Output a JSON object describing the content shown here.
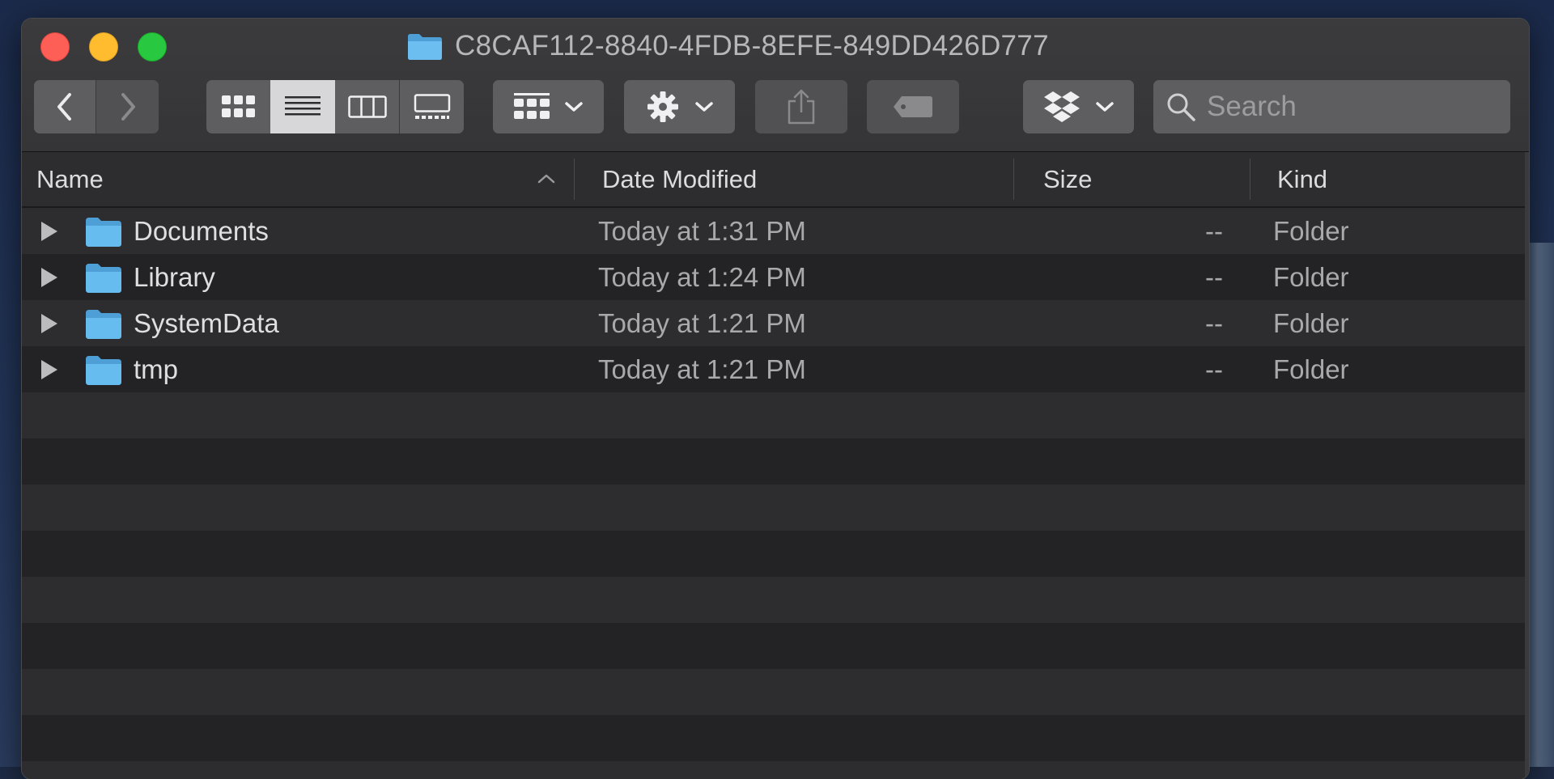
{
  "window": {
    "title": "C8CAF112-8840-4FDB-8EFE-849DD426D777"
  },
  "toolbar": {
    "back_icon": "chevron-left-icon",
    "forward_icon": "chevron-right-icon",
    "view_modes": [
      "icon-view",
      "list-view",
      "column-view",
      "gallery-view"
    ],
    "active_view": "list-view",
    "group_icon": "group-by-icon",
    "action_icon": "gear-icon",
    "share_icon": "share-icon",
    "tags_icon": "tag-icon",
    "dropbox_icon": "dropbox-icon",
    "search": {
      "placeholder": "Search",
      "value": ""
    }
  },
  "columns": {
    "name": "Name",
    "date_modified": "Date Modified",
    "size": "Size",
    "kind": "Kind"
  },
  "files": [
    {
      "name": "Documents",
      "date_modified": "Today at 1:31 PM",
      "size": "--",
      "kind": "Folder"
    },
    {
      "name": "Library",
      "date_modified": "Today at 1:24 PM",
      "size": "--",
      "kind": "Folder"
    },
    {
      "name": "SystemData",
      "date_modified": "Today at 1:21 PM",
      "size": "--",
      "kind": "Folder"
    },
    {
      "name": "tmp",
      "date_modified": "Today at 1:21 PM",
      "size": "--",
      "kind": "Folder"
    }
  ],
  "colors": {
    "folder_blue": "#5fb6ea",
    "close": "#fd5f57",
    "minimize": "#febc2e",
    "zoom": "#28c840"
  }
}
